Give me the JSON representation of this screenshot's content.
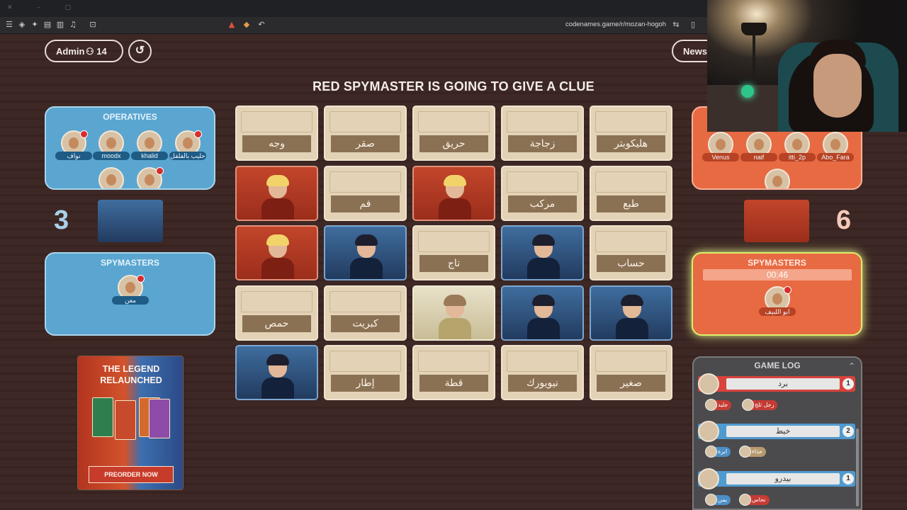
{
  "browser": {
    "url": "codenames.game/r/mozan-hogoh"
  },
  "header": {
    "admin_label": "Admin",
    "player_count": "14",
    "news_label": "News",
    "banner": "RED SPYMASTER IS GOING TO GIVE A CLUE"
  },
  "blue_team": {
    "operatives_title": "OPERATIVES",
    "operatives": [
      "نواف",
      "moodx",
      "khalid",
      "حليب بالفلفل"
    ],
    "score": "3",
    "spymasters_title": "SPYMASTERS",
    "spymaster": "معن"
  },
  "red_team": {
    "operatives": [
      "Venus",
      "naif",
      "itti_2p",
      "Abo_Fara"
    ],
    "score": "6",
    "spymasters_title": "SPYMASTERS",
    "timer": "00:46",
    "spymaster": "ابو اللبيف"
  },
  "board": {
    "cards": [
      {
        "type": "word",
        "text": "وجه"
      },
      {
        "type": "word",
        "text": "صقر"
      },
      {
        "type": "word",
        "text": "حريق"
      },
      {
        "type": "word",
        "text": "زجاجة"
      },
      {
        "type": "word",
        "text": "هليكوبتر"
      },
      {
        "type": "red"
      },
      {
        "type": "word",
        "text": "فم"
      },
      {
        "type": "red"
      },
      {
        "type": "word",
        "text": "مركب"
      },
      {
        "type": "word",
        "text": "طبع"
      },
      {
        "type": "red"
      },
      {
        "type": "blue"
      },
      {
        "type": "word",
        "text": "تاج"
      },
      {
        "type": "blue"
      },
      {
        "type": "word",
        "text": "حساب"
      },
      {
        "type": "word",
        "text": "حمص"
      },
      {
        "type": "word",
        "text": "كبريت"
      },
      {
        "type": "bystander"
      },
      {
        "type": "blue"
      },
      {
        "type": "blue"
      },
      {
        "type": "blue"
      },
      {
        "type": "word",
        "text": "إطار"
      },
      {
        "type": "word",
        "text": "قطة"
      },
      {
        "type": "word",
        "text": "نيويورك"
      },
      {
        "type": "word",
        "text": "صغير"
      }
    ]
  },
  "game_log": {
    "title": "GAME LOG",
    "entries": [
      {
        "team": "red",
        "clue": "برد",
        "number": "1",
        "guesses": [
          "جليد",
          "رجل ثلج"
        ]
      },
      {
        "team": "blue",
        "clue": "خيط",
        "number": "2",
        "guesses": [
          "ابرة",
          "حذاء"
        ]
      },
      {
        "team": "blue",
        "clue": "بيدرو",
        "number": "1",
        "guesses": [
          "يمن",
          "نحاس"
        ]
      }
    ]
  },
  "ad": {
    "title_line1": "THE LEGEND",
    "title_line2": "RELAUNCHED",
    "button": "PREORDER NOW"
  },
  "colors": {
    "red_team": "#e76a43",
    "blue_team": "#5aa6d0",
    "word_card": "#e3d2b6",
    "background": "#3a2724"
  }
}
